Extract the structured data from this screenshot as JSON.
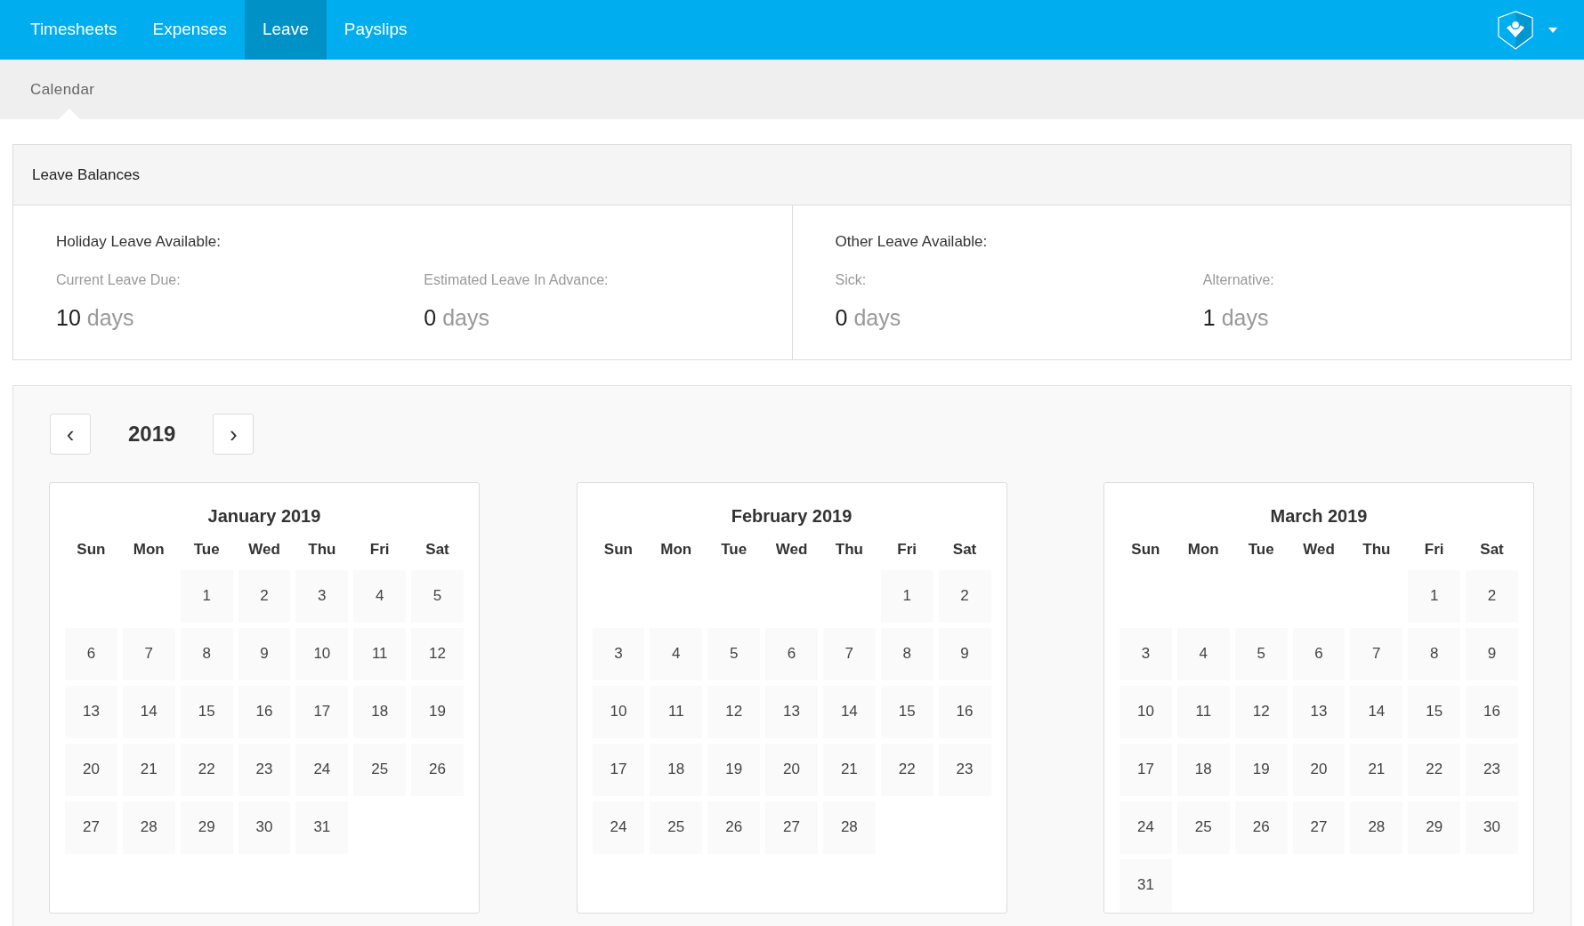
{
  "nav": {
    "tabs": [
      {
        "label": "Timesheets",
        "selected": false
      },
      {
        "label": "Expenses",
        "selected": false
      },
      {
        "label": "Leave",
        "selected": true
      },
      {
        "label": "Payslips",
        "selected": false
      }
    ]
  },
  "subnav": {
    "tabs": [
      {
        "label": "Calendar",
        "selected": true
      }
    ]
  },
  "leave_balances": {
    "title": "Leave Balances",
    "groups": [
      {
        "title": "Holiday Leave Available:",
        "items": [
          {
            "label": "Current Leave Due:",
            "value": "10",
            "unit": "days"
          },
          {
            "label": "Estimated Leave In Advance:",
            "value": "0",
            "unit": "days"
          }
        ]
      },
      {
        "title": "Other Leave Available:",
        "items": [
          {
            "label": "Sick:",
            "value": "0",
            "unit": "days"
          },
          {
            "label": "Alternative:",
            "value": "1",
            "unit": "days"
          }
        ]
      }
    ]
  },
  "calendar": {
    "year": "2019",
    "prev": "‹",
    "next": "›",
    "months": [
      {
        "title": "January 2019",
        "weekdays": [
          "Sun",
          "Mon",
          "Tue",
          "Wed",
          "Thu",
          "Fri",
          "Sat"
        ],
        "weeks": [
          {
            "kind": "first",
            "days": [
              "1",
              "2",
              "3",
              "4",
              "5"
            ]
          },
          {
            "kind": "week",
            "days": [
              "6",
              "7",
              "8",
              "9",
              "10",
              "11",
              "12"
            ]
          },
          {
            "kind": "week",
            "days": [
              "13",
              "14",
              "15",
              "16",
              "17",
              "18",
              "19"
            ]
          },
          {
            "kind": "week",
            "days": [
              "20",
              "21",
              "22",
              "23",
              "24",
              "25",
              "26"
            ]
          },
          {
            "kind": "week",
            "days": [
              "27",
              "28",
              "29",
              "30",
              "31"
            ]
          }
        ]
      },
      {
        "title": "February 2019",
        "weekdays": [
          "Sun",
          "Mon",
          "Tue",
          "Wed",
          "Thu",
          "Fri",
          "Sat"
        ],
        "weeks": [
          {
            "kind": "first",
            "days": [
              "1",
              "2"
            ]
          },
          {
            "kind": "week",
            "days": [
              "3",
              "4",
              "5",
              "6",
              "7",
              "8",
              "9"
            ]
          },
          {
            "kind": "week",
            "days": [
              "10",
              "11",
              "12",
              "13",
              "14",
              "15",
              "16"
            ]
          },
          {
            "kind": "week",
            "days": [
              "17",
              "18",
              "19",
              "20",
              "21",
              "22",
              "23"
            ]
          },
          {
            "kind": "week",
            "days": [
              "24",
              "25",
              "26",
              "27",
              "28"
            ]
          }
        ]
      },
      {
        "title": "March 2019",
        "weekdays": [
          "Sun",
          "Mon",
          "Tue",
          "Wed",
          "Thu",
          "Fri",
          "Sat"
        ],
        "weeks": [
          {
            "kind": "first",
            "days": [
              "1",
              "2"
            ]
          },
          {
            "kind": "week",
            "days": [
              "3",
              "4",
              "5",
              "6",
              "7",
              "8",
              "9"
            ]
          },
          {
            "kind": "week",
            "days": [
              "10",
              "11",
              "12",
              "13",
              "14",
              "15",
              "16"
            ]
          },
          {
            "kind": "week",
            "days": [
              "17",
              "18",
              "19",
              "20",
              "21",
              "22",
              "23"
            ]
          },
          {
            "kind": "week",
            "days": [
              "24",
              "25",
              "26",
              "27",
              "28",
              "29",
              "30"
            ]
          },
          {
            "kind": "week",
            "days": [
              "31"
            ]
          }
        ]
      }
    ]
  }
}
